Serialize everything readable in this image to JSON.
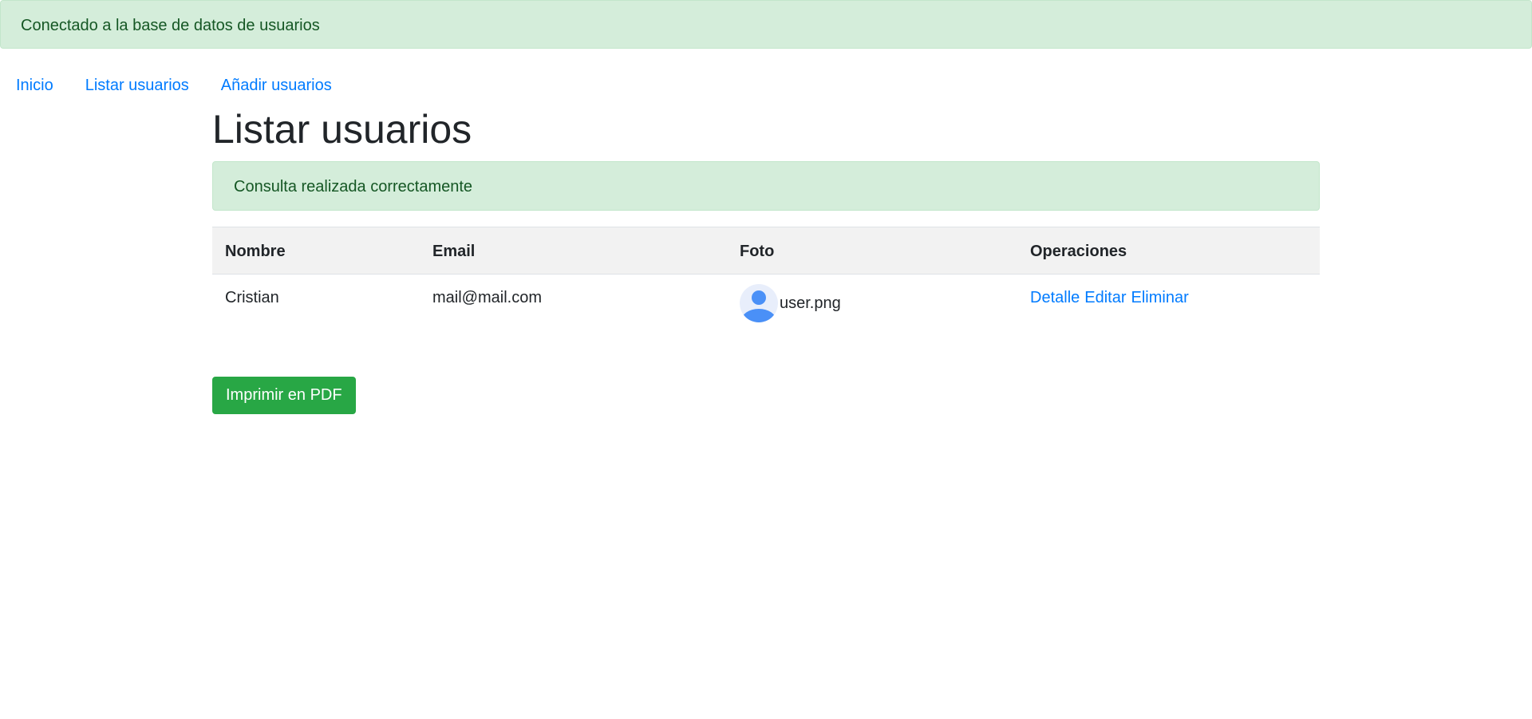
{
  "top_alert": {
    "text": "Conectado a la base de datos de usuarios"
  },
  "nav": {
    "items": [
      {
        "label": "Inicio"
      },
      {
        "label": "Listar usuarios"
      },
      {
        "label": "Añadir usuarios"
      }
    ]
  },
  "page": {
    "title": "Listar usuarios"
  },
  "result_alert": {
    "text": "Consulta realizada correctamente"
  },
  "table": {
    "headers": [
      "Nombre",
      "Email",
      "Foto",
      "Operaciones"
    ],
    "rows": [
      {
        "nombre": "Cristian",
        "email": "mail@mail.com",
        "foto": "user.png",
        "operations": [
          "Detalle",
          "Editar",
          "Eliminar"
        ]
      }
    ]
  },
  "actions": {
    "print_pdf_label": "Imprimir en PDF"
  },
  "colors": {
    "link": "#007bff",
    "success_bg": "#d4edda",
    "success_text": "#155724",
    "button_success": "#28a745",
    "avatar": "#4a90f7"
  }
}
